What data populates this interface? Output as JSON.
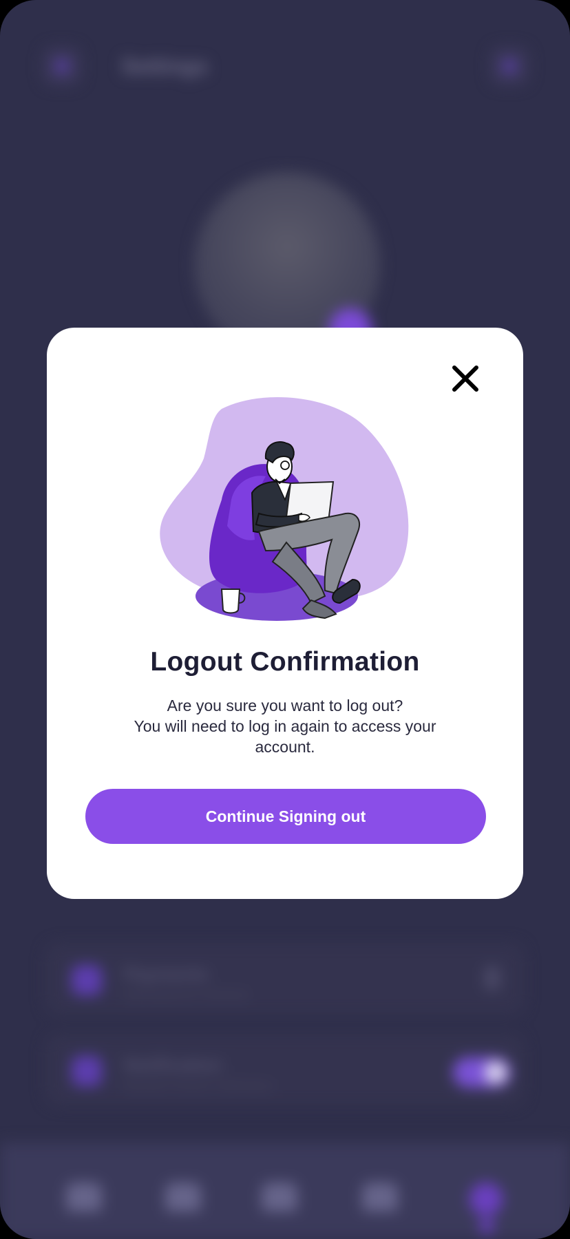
{
  "background": {
    "header": {
      "title": "Settings",
      "menu_icon": "menu-icon",
      "action_icon": "bell-icon"
    },
    "cards": [
      {
        "title": "Payments",
        "subtitle": "Add payment methods",
        "control": "chevron-right-icon"
      },
      {
        "title": "Notification",
        "subtitle": "Receive invoice notification",
        "control": "toggle"
      }
    ],
    "bottom_nav": [
      "home-icon",
      "calendar-icon",
      "wallet-icon",
      "briefcase-icon",
      "profile-icon"
    ]
  },
  "modal": {
    "close_icon": "close-icon",
    "illustration": "person-on-beanbag-with-laptop",
    "title": "Logout Confirmation",
    "body_lines": [
      "Are you sure you want to log out?",
      "You will need to log in again to access your",
      "account."
    ],
    "primary_button": "Continue Signing out"
  },
  "colors": {
    "accent": "#8a4ee8",
    "blob": "#d2b9f0",
    "beanbag": "#6a28c8",
    "overlay_bg": "#2f2f4b",
    "title": "#1e1e35"
  }
}
